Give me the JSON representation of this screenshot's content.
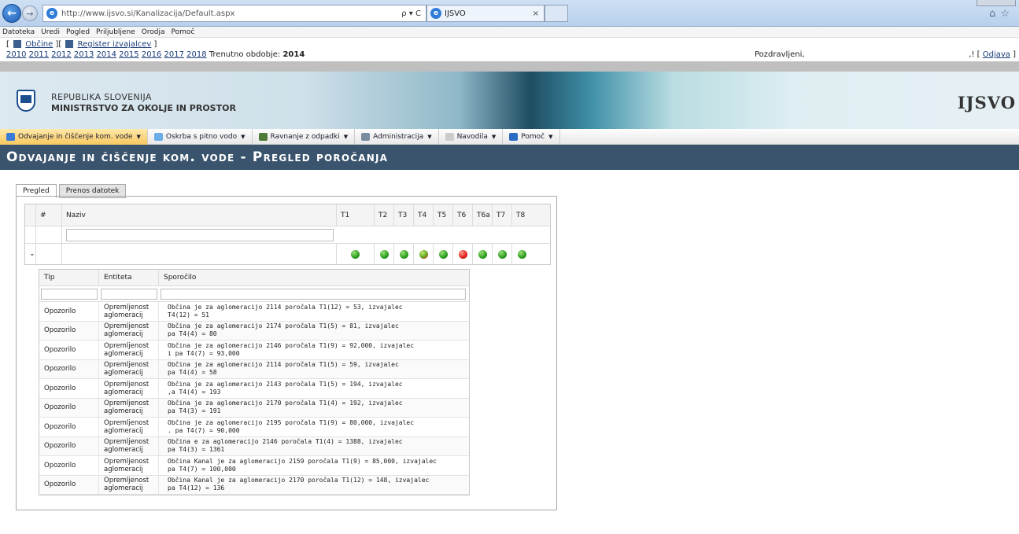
{
  "browser": {
    "url": "http://www.ijsvo.si/Kanalizacija/Default.aspx",
    "address_tools": "ρ ▾ C",
    "tab_title": "IJSVO",
    "tab_close": "×"
  },
  "menubar": [
    "Datoteka",
    "Uredi",
    "Pogled",
    "Priljubljene",
    "Orodja",
    "Pomoč"
  ],
  "topinfo": {
    "open_bracket": "[",
    "obcine": "Občine",
    "mid_bracket": "][",
    "register": "Register izvajalcev",
    "close_bracket": "]",
    "years": [
      "2010",
      "2011",
      "2012",
      "2013",
      "2014",
      "2015",
      "2016",
      "2017",
      "2018"
    ],
    "period_label": "Trenutno obdobje:",
    "period_value": "2014",
    "greeting": "Pozdravljeni,",
    "greeting_tail": ",! [",
    "logout": "Odjava",
    "logout_end": "]"
  },
  "banner": {
    "republic": "REPUBLIKA SLOVENIJA",
    "ministry": "MINISTRSTVO ZA OKOLJE IN PROSTOR",
    "brand": "IJSVO"
  },
  "navmenu": [
    {
      "label": "Odvajanje in čiščenje kom. vode",
      "color": "#3a7bd5"
    },
    {
      "label": "Oskrba s pitno vodo",
      "color": "#6aaee8"
    },
    {
      "label": "Ravnanje z odpadki",
      "color": "#4e7a3a"
    },
    {
      "label": "Administracija",
      "color": "#7a8ca0"
    },
    {
      "label": "Navodila",
      "color": "#cccccc"
    },
    {
      "label": "Pomoč",
      "color": "#2b6cc4"
    }
  ],
  "page_title": "Odvajanje in čiščenje kom. vode - Pregled poročanja",
  "tabs": [
    "Pregled",
    "Prenos datotek"
  ],
  "grid": {
    "headers": [
      "#",
      "Naziv",
      "T1",
      "T2",
      "T3",
      "T4",
      "T5",
      "T6",
      "T6a",
      "T7",
      "T8"
    ],
    "expand_icon": "⌄",
    "statuses": [
      "ok",
      "ok",
      "ok",
      "mixed",
      "ok",
      "error",
      "ok",
      "ok",
      "ok"
    ]
  },
  "detail": {
    "headers": [
      "Tip",
      "Entiteta",
      "Sporočilo"
    ],
    "rows": [
      {
        "tip": "Opozorilo",
        "entiteta": "Opremljenost aglomeracij",
        "msg1": "Občina        je za aglomeracijo 2114 poročala T1(12) = 53, izvajalec",
        "msg2": "                T4(12) = 51"
      },
      {
        "tip": "Opozorilo",
        "entiteta": "Opremljenost aglomeracij",
        "msg1": "Občina        je za aglomeracijo 2174 poročala T1(5) = 81, izvajalec",
        "msg2": "          pa T4(4) = 80"
      },
      {
        "tip": "Opozorilo",
        "entiteta": "Opremljenost aglomeracij",
        "msg1": "Občina        je za aglomeracijo 2146 poročala T1(9) = 92,000, izvajalec",
        "msg2": "               i pa T4(7) = 93,000"
      },
      {
        "tip": "Opozorilo",
        "entiteta": "Opremljenost aglomeracij",
        "msg1": "Občina        je za aglomeracijo 2114 poročala T1(5) = 59, izvajalec",
        "msg2": "          pa T4(4) = 58"
      },
      {
        "tip": "Opozorilo",
        "entiteta": "Opremljenost aglomeracij",
        "msg1": "Občina         je za aglomeracijo 2143 poročala T1(5) = 194, izvajalec",
        "msg2": "          ,a T4(4) = 193"
      },
      {
        "tip": "Opozorilo",
        "entiteta": "Opremljenost aglomeracij",
        "msg1": "Občina        je za aglomeracijo 2170 poročala T1(4) = 192, izvajalec",
        "msg2": "          pa T4(3) = 191"
      },
      {
        "tip": "Opozorilo",
        "entiteta": "Opremljenost aglomeracij",
        "msg1": "Občina        je za aglomeracijo 2195 poročala T1(9) = 80,000, izvajalec",
        "msg2": "              . pa T4(7) = 90,000"
      },
      {
        "tip": "Opozorilo",
        "entiteta": "Opremljenost aglomeracij",
        "msg1": "Občina         e za aglomeracijo 2146 poročala T1(4) = 1388, izvajalec",
        "msg2": "          pa T4(3) = 1361"
      },
      {
        "tip": "Opozorilo",
        "entiteta": "Opremljenost aglomeracij",
        "msg1": "Občina Kanal je za aglomeracijo 2159 poročala T1(9) = 85,000, izvajalec",
        "msg2": "               pa T4(7) = 100,000"
      },
      {
        "tip": "Opozorilo",
        "entiteta": "Opremljenost aglomeracij",
        "msg1": "Občina Kanal je za aglomeracijo 2170 poročala T1(12) = 148, izvajalec",
        "msg2": "          pa T4(12) = 136"
      }
    ]
  }
}
